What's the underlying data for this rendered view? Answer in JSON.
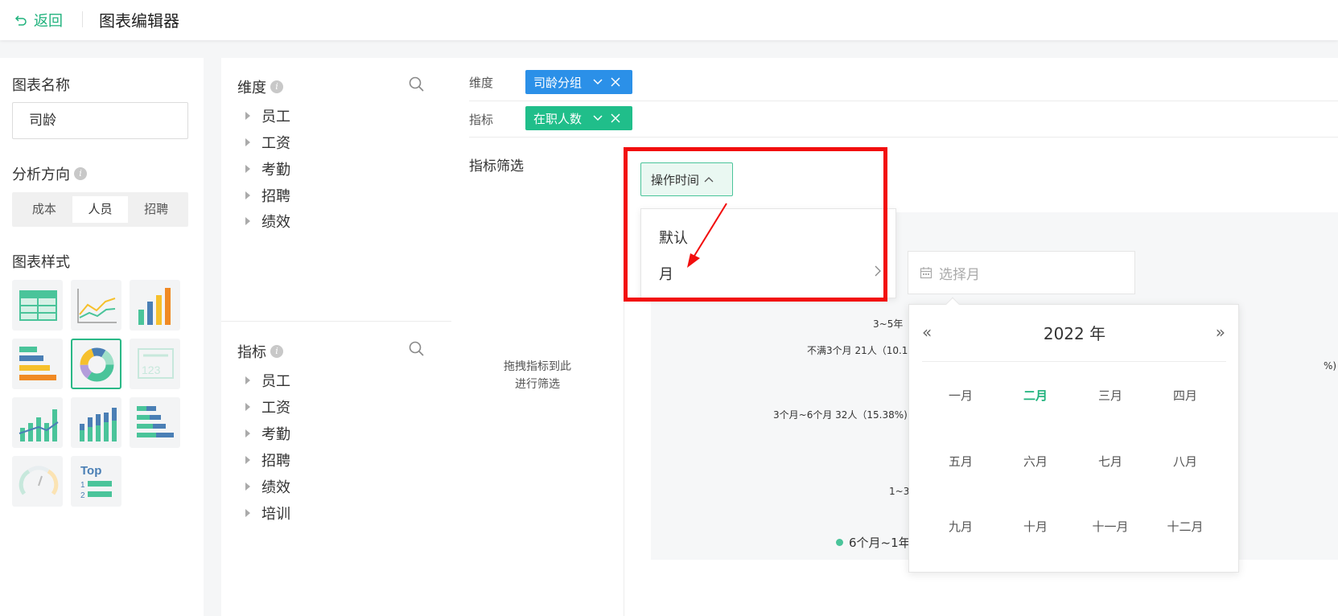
{
  "header": {
    "back_label": "返回",
    "title": "图表编辑器"
  },
  "left": {
    "name_label": "图表名称",
    "name_value": "司龄",
    "direction_label": "分析方向",
    "direction_options": [
      "成本",
      "人员",
      "招聘"
    ],
    "direction_selected": "人员",
    "style_label": "图表样式",
    "style_tiles": [
      "table-chart-icon",
      "line-chart-icon",
      "bar-chart-icon",
      "horizontal-bar-chart-icon",
      "donut-chart-icon",
      "number-card-icon",
      "bar-line-combo-icon",
      "stacked-bar-icon",
      "stacked-horizontal-bar-icon",
      "gauge-chart-icon",
      "top-ranking-icon"
    ],
    "style_selected": "donut-chart-icon",
    "number_card_text": "123",
    "top_tile": {
      "title": "Top",
      "rows": [
        "1",
        "2"
      ]
    }
  },
  "middle": {
    "dimension_title": "维度",
    "dimension_items": [
      "员工",
      "工资",
      "考勤",
      "招聘",
      "绩效"
    ],
    "metric_title": "指标",
    "metric_items": [
      "员工",
      "工资",
      "考勤",
      "招聘",
      "绩效",
      "培训"
    ]
  },
  "main": {
    "dimension_label": "维度",
    "dimension_chip": "司龄分组",
    "metric_label": "指标",
    "metric_chip": "在职人数",
    "filter_title": "指标筛选",
    "drop_hint": "拖拽指标到此进行筛选",
    "time_button": "操作时间",
    "dropdown_items": [
      "默认",
      "月"
    ],
    "month_placeholder": "选择月",
    "calendar": {
      "year_label": "2022 年",
      "months": [
        "一月",
        "二月",
        "三月",
        "四月",
        "五月",
        "六月",
        "七月",
        "八月",
        "九月",
        "十月",
        "十一月",
        "十二月"
      ],
      "selected_month": "二月"
    },
    "chart_labels": {
      "l1": "3~5年",
      "l2": "不满3个月 21人（10.1",
      "l3": "3个月~6个月 32人（15.38%)",
      "l4": "1~3",
      "l5": "%)"
    },
    "legend_item": "6个月~1年"
  },
  "colors": {
    "accent": "#1fb27c",
    "chip_blue": "#2b90e8",
    "chip_green": "#20be8a",
    "highlight": "#f20e0e"
  }
}
